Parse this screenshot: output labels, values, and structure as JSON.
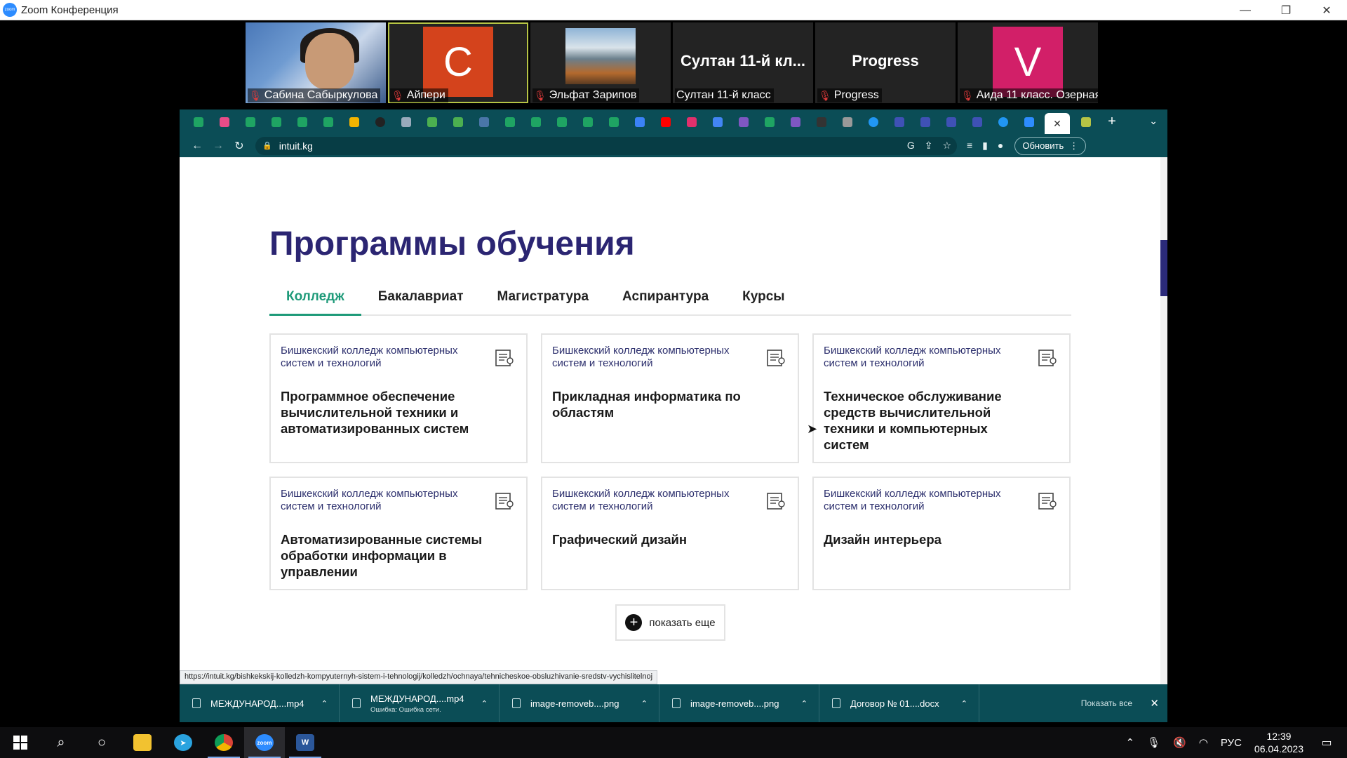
{
  "zoom": {
    "window_title": "Zoom Конференция",
    "minimize": "—",
    "restore": "❐",
    "close": "✕"
  },
  "participants": [
    {
      "name": "Сабина Сабыркулова",
      "kind": "photo"
    },
    {
      "name": "Айпери",
      "kind": "avatar",
      "initial": "C",
      "color": "#d4431c",
      "active": true
    },
    {
      "name": "Эльфат Зарипов",
      "kind": "landscape"
    },
    {
      "name": "Султан 11-й класс",
      "kind": "text",
      "bigname": "Султан 11-й кл..."
    },
    {
      "name": "Progress",
      "kind": "text",
      "bigname": "Progress"
    },
    {
      "name": "Аида 11 класс. Озерная",
      "kind": "avatar",
      "initial": "V",
      "color": "#d21f68"
    }
  ],
  "browser": {
    "address": "intuit.kg",
    "update_label": "Обновить",
    "status_url": "https://intuit.kg/bishkekskij-kolledzh-kompyuternyh-sistem-i-tehnologij/kolledzh/ochnaya/tehnicheskoe-obsluzhivanie-sredstv-vychislitelnoj",
    "tab_close": "✕",
    "new_tab": "+",
    "tab_menu": "⌄"
  },
  "page": {
    "heading": "Программы обучения",
    "tabs": [
      "Колледж",
      "Бакалавриат",
      "Магистратура",
      "Аспирантура",
      "Курсы"
    ],
    "active_tab": 0,
    "cards": [
      {
        "org": "Бишкекский колледж компьютерных систем и технологий",
        "title": "Программное обеспечение вычислительной техники и автоматизированных систем"
      },
      {
        "org": "Бишкекский колледж компьютерных систем и технологий",
        "title": "Прикладная информатика по областям"
      },
      {
        "org": "Бишкекский колледж компьютерных систем и технологий",
        "title": "Техническое обслуживание средств вычислительной техники и компьютерных систем"
      },
      {
        "org": "Бишкекский колледж компьютерных систем и технологий",
        "title": "Автоматизированные системы обработки информации в управлении"
      },
      {
        "org": "Бишкекский колледж компьютерных систем и технологий",
        "title": "Графический дизайн"
      },
      {
        "org": "Бишкекский колледж компьютерных систем и технологий",
        "title": "Дизайн интерьера"
      }
    ],
    "show_more": "показать еще"
  },
  "downloads": {
    "items": [
      {
        "name": "МЕЖДУНАРОД....mp4",
        "sub": ""
      },
      {
        "name": "МЕЖДУНАРОД....mp4",
        "sub": "Ошибка: Ошибка сети."
      },
      {
        "name": "image-removeb....png",
        "sub": ""
      },
      {
        "name": "image-removeb....png",
        "sub": ""
      },
      {
        "name": "Договор № 01....docx",
        "sub": ""
      }
    ],
    "show_all": "Показать все"
  },
  "taskbar": {
    "language": "РУС",
    "time": "12:39",
    "date": "06.04.2023"
  },
  "colors": {
    "accent_green": "#1e9a79",
    "heading_purple": "#2b2572",
    "chrome_teal": "#0b4d56"
  }
}
